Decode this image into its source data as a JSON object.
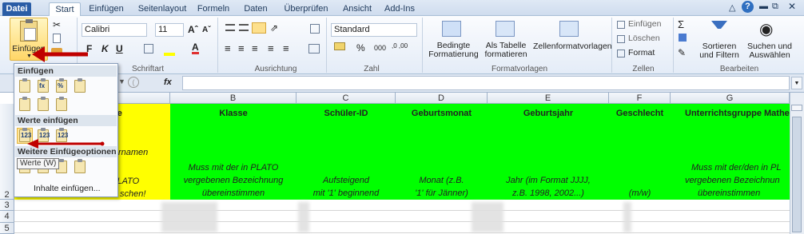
{
  "tabs": [
    "Datei",
    "Start",
    "Einfügen",
    "Seitenlayout",
    "Formeln",
    "Daten",
    "Überprüfen",
    "Ansicht",
    "Add-Ins"
  ],
  "ribbon": {
    "paste_label": "Einfügen",
    "font_name": "Calibri",
    "font_size": "11",
    "bold": "F",
    "italic": "K",
    "underline": "U",
    "number_format": "Standard",
    "percent": "%",
    "thousands": "000",
    "dec_inc": ",0 ,00",
    "cond_format": "Bedingte\nFormatierung",
    "as_table": "Als Tabelle\nformatieren",
    "cell_styles": "Zellenformatvorlagen",
    "insert": "Einfügen",
    "delete": "Löschen",
    "format": "Format",
    "sort_filter": "Sortieren\nund Filtern",
    "find_select": "Suchen und\nAuswählen",
    "groups": [
      "Schriftart",
      "Ausrichtung",
      "Zahl",
      "Formatvorlagen",
      "Zellen",
      "Bearbeiten"
    ]
  },
  "formula": {
    "fx": "fx"
  },
  "columns": [
    "B",
    "C",
    "D",
    "E",
    "F",
    "G"
  ],
  "rows": [
    "1",
    "2",
    "3",
    "4",
    "5"
  ],
  "sheet": {
    "a1_partial": "ne",
    "a2_partial_1": "rnamen",
    "a2_partial_2": "n PLATO",
    "a2_partial_3": "schen!",
    "headers": [
      "Klasse",
      "Schüler-ID",
      "Geburtsmonat",
      "Geburtsjahr",
      "Geschlecht",
      "Unterrichtsgruppe Mathe"
    ],
    "row2": [
      [
        "Muss mit der in PLATO",
        "vergebenen Bezeichnung",
        "übereinstimmen"
      ],
      [
        "Aufsteigend",
        "mit '1' beginnend"
      ],
      [
        "Monat (z.B.",
        "'1' für Jänner)"
      ],
      [
        "Jahr (im Format JJJJ,",
        "z.B. 1998, 2002...)"
      ],
      [
        "(m/w)"
      ],
      [
        "Muss mit der/den in PL",
        "vergebenen Bezeichnun",
        "übereinstimmen"
      ]
    ]
  },
  "menu": {
    "sec1": "Einfügen",
    "sec2": "Werte einfügen",
    "sec3": "Weitere Einfügeoptionen",
    "tooltip": "Werte (W)",
    "inhalte": "Inhalte einfügen...",
    "value_icon_text": "123"
  },
  "colors": {
    "green": "#00ff00",
    "yellow": "#ffff00",
    "arrow": "#c00000",
    "file_tab": "#2a5da6"
  }
}
